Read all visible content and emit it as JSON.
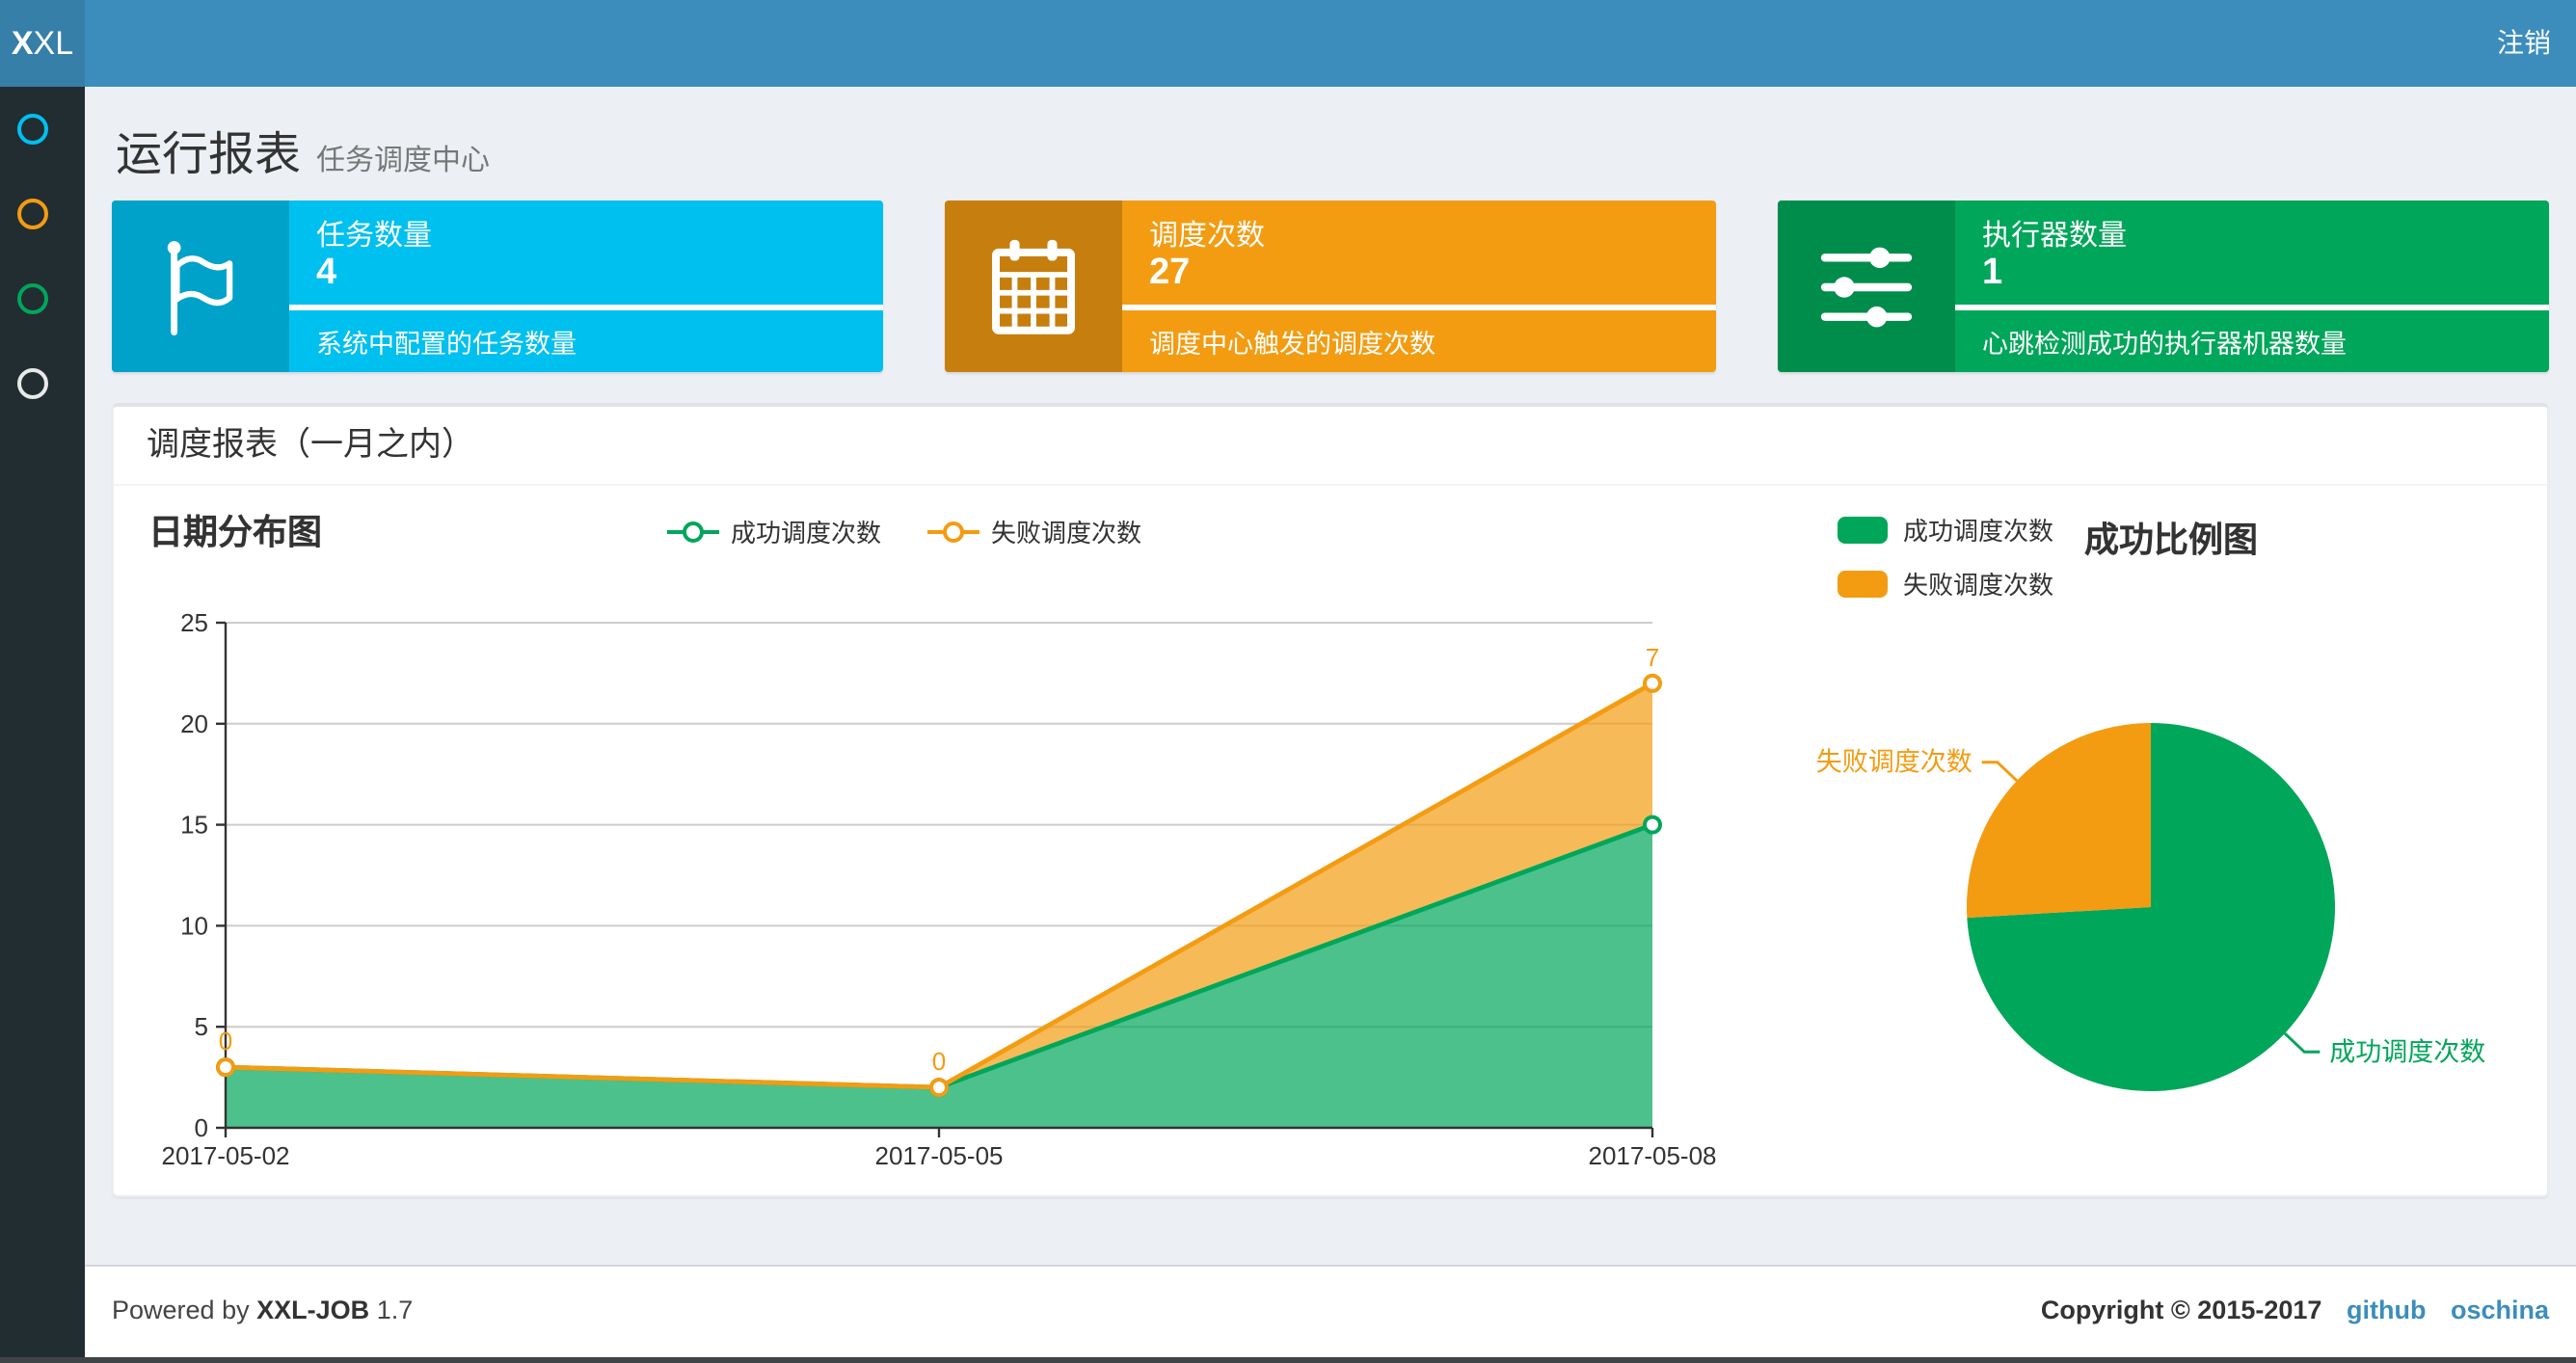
{
  "navbar": {
    "logo_bold": "X",
    "logo_rest": "XL",
    "logout_label": "注销"
  },
  "sidebar": {
    "items": [
      {
        "icon": "circle-icon",
        "color": "#00c0ef"
      },
      {
        "icon": "circle-icon",
        "color": "#f39c12"
      },
      {
        "icon": "circle-icon",
        "color": "#00a65a"
      },
      {
        "icon": "circle-icon",
        "color": "#e9e9e9"
      }
    ]
  },
  "page_header": {
    "title": "运行报表",
    "subtitle": "任务调度中心"
  },
  "stat_cards": [
    {
      "icon": "flag-icon",
      "title": "任务数量",
      "value": "4",
      "desc": "系统中配置的任务数量",
      "color": "#00c0ef",
      "icon_color": "#00a2c9"
    },
    {
      "icon": "calendar-icon",
      "title": "调度次数",
      "value": "27",
      "desc": "调度中心触发的调度次数",
      "color": "#f39c12",
      "icon_color": "#c67f0e"
    },
    {
      "icon": "sliders-icon",
      "title": "执行器数量",
      "value": "1",
      "desc": "心跳检测成功的执行器机器数量",
      "color": "#00a65a",
      "icon_color": "#008d4c"
    }
  ],
  "panel": {
    "title": "调度报表（一月之内）"
  },
  "chart_data": [
    {
      "type": "area",
      "title": "日期分布图",
      "categories": [
        "2017-05-02",
        "2017-05-05",
        "2017-05-08"
      ],
      "series": [
        {
          "name": "成功调度次数",
          "values": [
            3,
            2,
            15
          ],
          "color": "#00a65a"
        },
        {
          "name": "失败调度次数",
          "values": [
            0,
            0,
            7
          ],
          "color": "#f39c12"
        }
      ],
      "stacked": true,
      "ylim": [
        0,
        25
      ],
      "ytick_step": 5,
      "yticks": [
        0,
        5,
        10,
        15,
        20,
        25
      ],
      "point_labels_series": "失败调度次数",
      "point_labels": [
        "0",
        "0",
        "7"
      ],
      "grid": true,
      "legend_position": "top-center"
    },
    {
      "type": "pie",
      "title": "成功比例图",
      "slices": [
        {
          "label": "成功调度次数",
          "value": 20,
          "color": "#00a65a"
        },
        {
          "label": "失败调度次数",
          "value": 7,
          "color": "#f39c12"
        }
      ],
      "start_angle_deg": -90,
      "clockwise": true,
      "legend_position": "top-left"
    }
  ],
  "footer": {
    "powered_by_prefix": "Powered by",
    "product": "XXL-JOB",
    "version": "1.7",
    "copyright": "Copyright © 2015-2017",
    "links": [
      {
        "label": "github"
      },
      {
        "label": "oschina"
      }
    ]
  },
  "colors": {
    "navbar": "#3c8dbc",
    "logo_bg": "#367fa9",
    "sidebar": "#222d32",
    "background": "#ecf0f5",
    "link": "#3c8dbc"
  }
}
